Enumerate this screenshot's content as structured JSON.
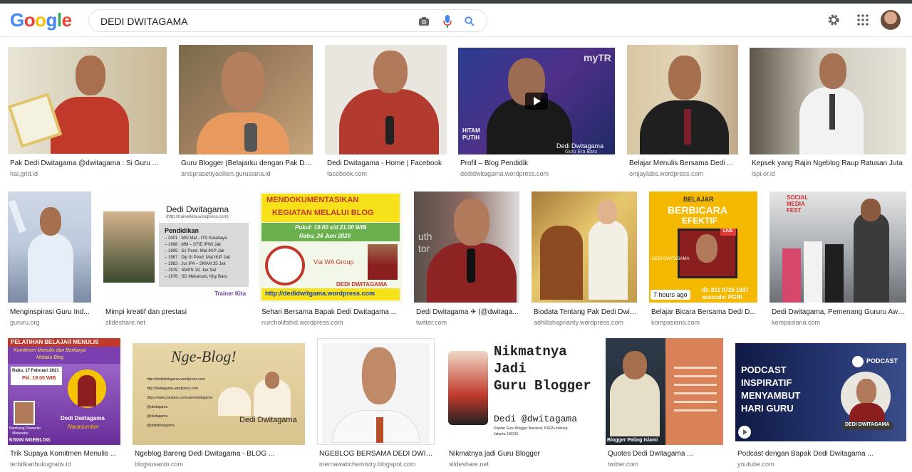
{
  "logo": {
    "letters": [
      "G",
      "o",
      "o",
      "g",
      "l",
      "e"
    ],
    "colors": [
      "#4285f4",
      "#ea4335",
      "#fbbc05",
      "#4285f4",
      "#34a853",
      "#ea4335"
    ]
  },
  "search": {
    "value": "DEDI DWITAGAMA"
  },
  "icons": {
    "camera": "camera-icon",
    "mic": "microphone-icon",
    "search": "search-icon",
    "settings": "gear-icon",
    "apps": "apps-grid-icon"
  },
  "results": [
    {
      "caption": "Pak Dedi Dwitagama @dwitagama : Si Guru ...",
      "source": "hai.grid.id"
    },
    {
      "caption": "Guru Blogger (Belajarku dengan Pak De...",
      "source": "anisprasetiyaollien.gurusiana.id"
    },
    {
      "caption": "Dedi Dwitagama - Home | Facebook",
      "source": "facebook.com"
    },
    {
      "caption": "Profil – Blog Pendidik",
      "source": "dedidwitagama.wordpress.com",
      "overlay": [
        "myTR",
        "HITAM",
        "PUTIH",
        "Dedi Dwitagama",
        "Guru Era Baru"
      ]
    },
    {
      "caption": "Belajar Menulis Bersama Dedi ...",
      "source": "omjaylabs.wordpress.com"
    },
    {
      "caption": "Kepsek yang Rajin Ngeblog Raup Ratusan Juta",
      "source": "lspi.or.id"
    },
    {
      "caption": "Menginspirasi Guru Ind...",
      "source": "gururu.org"
    },
    {
      "caption": "Mimpi kreatif dan prestasi",
      "source": "slideshare.net",
      "overlay": [
        "Dedi Dwitagama",
        "(http://trainerkita.wordpress.com)",
        "Pendidikan",
        "– 2001 : MSi Mat - ITS Surabaya",
        "– 1998 : MM – STIE IPWI Jak",
        "– 1995 : S1 Pend. Mat IKIP Jak",
        "– 1987 : Dip III Pend. Mat IKIP Jak",
        "– 1983 : Jur IPA – SMAN 35 Jak",
        "– 1979 : SMPN 19, Jak Sel",
        "– 1976 : SD Mekarsari, Kby Baru",
        "Trainer Kita"
      ]
    },
    {
      "caption": "Sehari Bersama Bapak Dedi Dwitagama ...",
      "source": "nurcholifahid.wordpress.com",
      "overlay": [
        "MENDOKUMENTASIKAN",
        "KEGIATAN MELALUI BLOG",
        "Pukul: 19.00 s/d 21.00 WIB",
        "Rabu, 24 Juni 2020",
        "Via WA Group",
        "DEDI DWITAGAMA",
        "http://dedidwitgama.wordpress.com"
      ]
    },
    {
      "caption": "Dedi Dwitagama ✈ (@dwitaga...",
      "source": "twitter.com",
      "overlay": [
        "uth",
        "tor"
      ]
    },
    {
      "caption": "Biodata Tentang Pak Dedi Dwit...",
      "source": "adhillahaprianty.wordpress.com"
    },
    {
      "caption": "Belajar Bicara Bersama Dedi D...",
      "source": "kompasiana.com",
      "badge": "7 hours ago",
      "overlay": [
        "BELAJAR",
        "BERBICARA",
        "EFEKTIF",
        "LIVE",
        "DEDI DWITAGAMA",
        "ID: 811 0726 1937",
        "asscode: PGRI"
      ]
    },
    {
      "caption": "Dedi Dwitagama, Pemenang Gururu Awa...",
      "source": "kompasiana.com",
      "overlay": [
        "SOCIAL",
        "MEDIA",
        "FEST"
      ]
    },
    {
      "caption": "Trik Supaya Komitmen Menulis ...",
      "source": "terbitkanbukugratis.id",
      "overlay": [
        "PELATIHAN BELAJAR MENULIS",
        "Komitmen Menulis dan Berkarya",
        "Melalui Blog",
        "Rabu, 17 Februari 2021",
        "Pkl. 19.00 WIB",
        "Dedi Dwitagama",
        "Narasumber",
        "Bambang Purwanto",
        "Moderator",
        "KSGN NGEBLOG"
      ]
    },
    {
      "caption": "Ngeblog Bareng Dedi Dwitagama - BLOG ...",
      "source": "blogsusanto.com",
      "overlay": [
        "Nge-Blog!",
        "http://dedidwitagama.wordpress.com",
        "http://dwitagama.wordpress.com",
        "https://www.youtube.com/user/dwitagama",
        "@dwitagama",
        "@dwitagama",
        "@dedidwitagama",
        "Dedi Dwitagama"
      ]
    },
    {
      "caption": "NGEBLOG BERSAMA DEDI DWITA...",
      "source": "mernawatichemistry.blogspot.com"
    },
    {
      "caption": "Nikmatnya jadi Guru Blogger",
      "source": "slideshare.net",
      "overlay": [
        "Nikmatnya",
        "Jadi",
        "Guru Blogger",
        "Dedi @dwitagama",
        "Kopdar Guru Blogger Nasional, KSGN-Indosat,",
        "Jakarta 150315"
      ]
    },
    {
      "caption": "Quotes Dedi Dwitagama ...",
      "source": "twitter.com",
      "overlay": [
        "Blogger Paling Islami"
      ]
    },
    {
      "caption": "Podcast dengan Bapak Dedi Dwitagama ...",
      "source": "youtube.com",
      "overlay": [
        "PODCAST",
        "PODCAST",
        "INSPIRATIF",
        "MENYAMBUT",
        "HARI GURU",
        "DEDI DWITAGAMA"
      ]
    }
  ]
}
